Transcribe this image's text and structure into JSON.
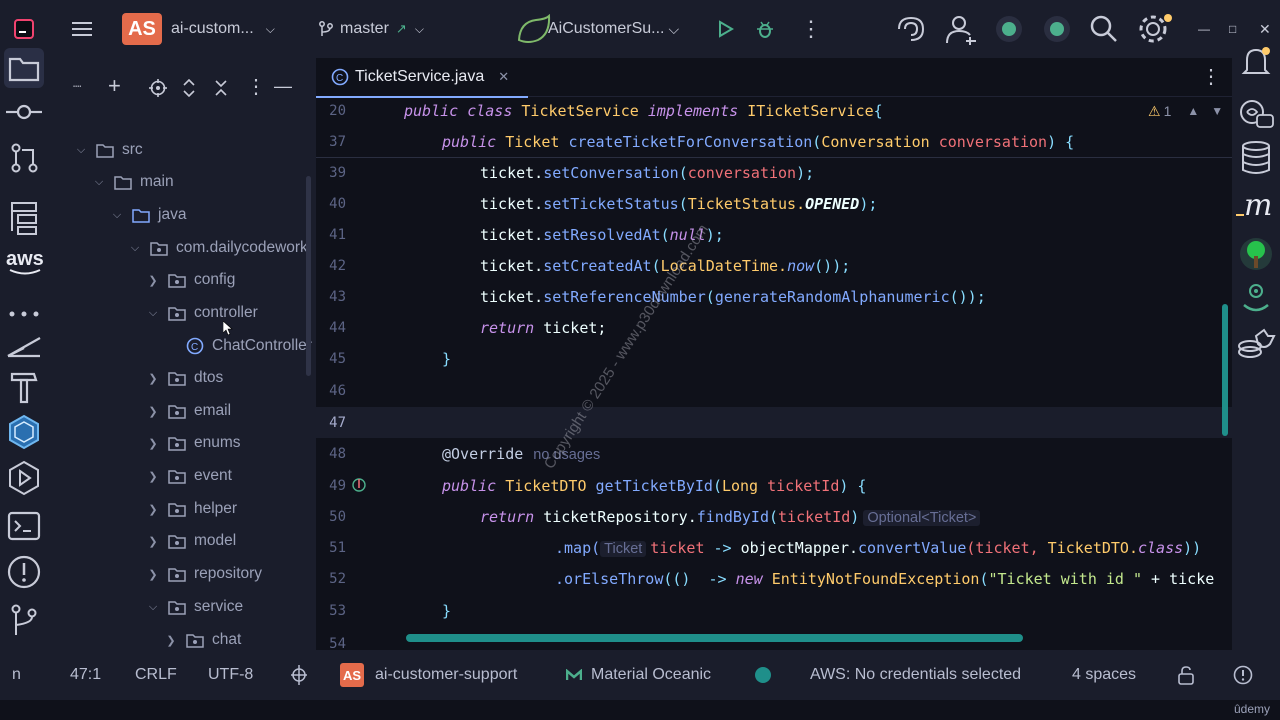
{
  "titlebar": {
    "project_badge": "AS",
    "project_name": "ai-custom...",
    "branch": "master",
    "run_config": "AiCustomerSu..."
  },
  "project_panel": {
    "items": [
      {
        "label": "src",
        "expanded": true
      },
      {
        "label": "main",
        "expanded": true
      },
      {
        "label": "java",
        "expanded": true
      },
      {
        "label": "com.dailycodework",
        "expanded": true
      },
      {
        "label": "config",
        "expanded": false
      },
      {
        "label": "controller",
        "expanded": true
      },
      {
        "label": "ChatController",
        "type": "class"
      },
      {
        "label": "dtos",
        "expanded": false
      },
      {
        "label": "email",
        "expanded": false
      },
      {
        "label": "enums",
        "expanded": false
      },
      {
        "label": "event",
        "expanded": false
      },
      {
        "label": "helper",
        "expanded": false
      },
      {
        "label": "model",
        "expanded": false
      },
      {
        "label": "repository",
        "expanded": false
      },
      {
        "label": "service",
        "expanded": true
      },
      {
        "label": "chat",
        "expanded": false
      }
    ]
  },
  "editor": {
    "tab_label": "TicketService.java",
    "warning_count": "1",
    "usages_hint": "no usages",
    "inlay_hint_optional": "Optional<Ticket>",
    "inlay_hint_ticket": "Ticket",
    "line_numbers": [
      "20",
      "37",
      "39",
      "40",
      "41",
      "42",
      "43",
      "44",
      "45",
      "46",
      "47",
      "48",
      "49",
      "50",
      "51",
      "52",
      "53",
      "54"
    ],
    "code": {
      "l20_a": "public class ",
      "l20_b": "TicketService ",
      "l20_c": "implements ",
      "l20_d": "ITicketService",
      "l20_e": "{",
      "l37_a": "public ",
      "l37_b": "Ticket ",
      "l37_c": "createTicketForConversation",
      "l37_d": "(",
      "l37_e": "Conversation ",
      "l37_f": "conversation",
      "l37_g": ") {",
      "l39_a": "ticket.",
      "l39_b": "setConversation",
      "l39_c": "(",
      "l39_d": "conversation",
      "l39_e": ");",
      "l40_a": "ticket.",
      "l40_b": "setTicketStatus",
      "l40_c": "(",
      "l40_d": "TicketStatus.",
      "l40_e": "OPENED",
      "l40_f": ");",
      "l41_a": "ticket.",
      "l41_b": "setResolvedAt",
      "l41_c": "(",
      "l41_d": "null",
      "l41_e": ");",
      "l42_a": "ticket.",
      "l42_b": "setCreatedAt",
      "l42_c": "(",
      "l42_d": "LocalDateTime.",
      "l42_e": "now",
      "l42_f": "());",
      "l43_a": "ticket.",
      "l43_b": "setReferenceNumber",
      "l43_c": "(",
      "l43_d": "generateRandomAlphanumeric",
      "l43_e": "());",
      "l44_a": "return ",
      "l44_b": "ticket;",
      "l45": "}",
      "l48": "@Override",
      "l49_a": "public ",
      "l49_b": "TicketDTO ",
      "l49_c": "getTicketById",
      "l49_d": "(",
      "l49_e": "Long ",
      "l49_f": "ticketId",
      "l49_g": ") {",
      "l50_a": "return ",
      "l50_b": "ticketRepository.",
      "l50_c": "findById",
      "l50_d": "(",
      "l50_e": "ticketId",
      "l50_f": ")",
      "l51_a": ".map(",
      "l51_b": "ticket",
      "l51_c": " -> ",
      "l51_d": "objectMapper.",
      "l51_e": "convertValue",
      "l51_f": "(ticket, ",
      "l51_g": "TicketDTO.",
      "l51_h": "class",
      "l51_i": "))",
      "l52_a": ".orElseThrow",
      "l52_b": "(()  -> ",
      "l52_c": "new ",
      "l52_d": "EntityNotFoundException",
      "l52_e": "(",
      "l52_f": "\"Ticket with id \"",
      "l52_g": " + ticke",
      "l53": "}"
    }
  },
  "watermark": "Copyright © 2025 - www.p30download.com",
  "statusbar": {
    "left_fragment": "n",
    "position": "47:1",
    "line_separator": "CRLF",
    "encoding": "UTF-8",
    "project_badge": "AS",
    "project": "ai-customer-support",
    "theme": "Material Oceanic",
    "aws": "AWS: No credentials selected",
    "indent": "4 spaces"
  },
  "udemy": "ûdemy",
  "colors": {
    "accent": "#82aaff",
    "keyword": "#c792ea",
    "class": "#ffcb6b",
    "function": "#82aaff",
    "variable": "#f07178",
    "string": "#c3e88d"
  }
}
